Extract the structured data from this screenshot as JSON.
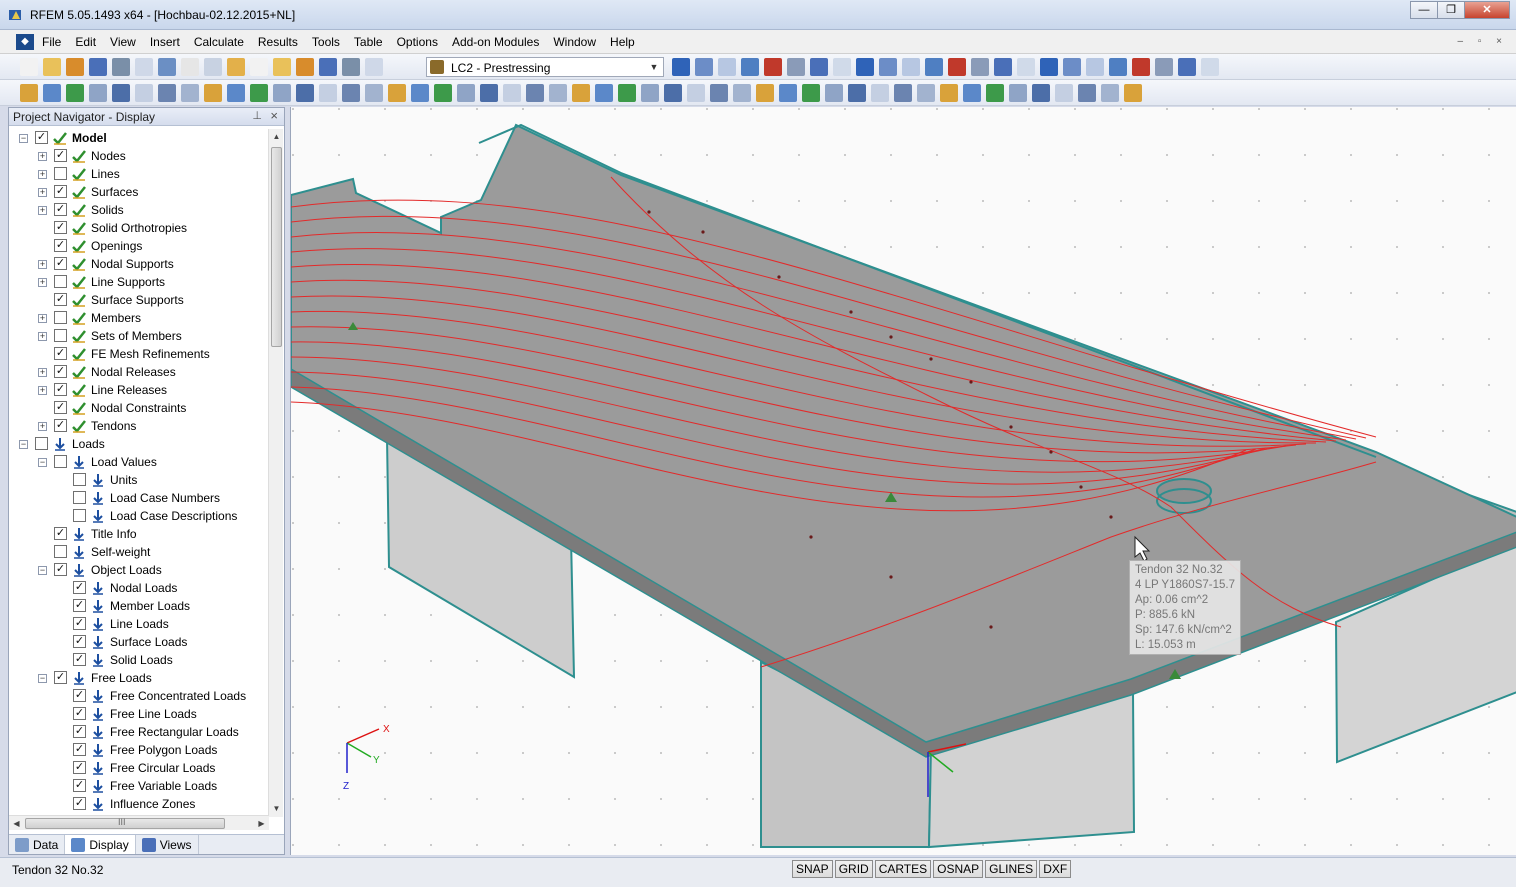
{
  "window": {
    "title": "RFEM 5.05.1493 x64 - [Hochbau-02.12.2015+NL]",
    "minimize": "—",
    "restore": "❐",
    "close": "✕"
  },
  "menu": {
    "items": [
      "File",
      "Edit",
      "View",
      "Insert",
      "Calculate",
      "Results",
      "Tools",
      "Table",
      "Options",
      "Add-on Modules",
      "Window",
      "Help"
    ],
    "mdi_controls": "‒ ▫ ×"
  },
  "toolbar": {
    "load_case": "LC2 - Prestressing"
  },
  "navigator": {
    "title": "Project Navigator - Display",
    "pin": "⊥",
    "close": "×",
    "items": [
      {
        "label": "Model",
        "level": 0,
        "exp": "−",
        "checked": true,
        "icon": "green-check-icon",
        "bold": true
      },
      {
        "label": "Nodes",
        "level": 1,
        "exp": "+",
        "checked": true,
        "icon": "green-check-icon"
      },
      {
        "label": "Lines",
        "level": 1,
        "exp": "+",
        "checked": false,
        "icon": "green-check-icon"
      },
      {
        "label": "Surfaces",
        "level": 1,
        "exp": "+",
        "checked": true,
        "icon": "green-check-icon"
      },
      {
        "label": "Solids",
        "level": 1,
        "exp": "+",
        "checked": true,
        "icon": "green-check-icon"
      },
      {
        "label": "Solid Orthotropies",
        "level": 1,
        "exp": "",
        "checked": true,
        "icon": "green-check-icon"
      },
      {
        "label": "Openings",
        "level": 1,
        "exp": "",
        "checked": true,
        "icon": "green-check-icon"
      },
      {
        "label": "Nodal Supports",
        "level": 1,
        "exp": "+",
        "checked": true,
        "icon": "green-check-icon"
      },
      {
        "label": "Line Supports",
        "level": 1,
        "exp": "+",
        "checked": false,
        "icon": "green-check-icon"
      },
      {
        "label": "Surface Supports",
        "level": 1,
        "exp": "",
        "checked": true,
        "icon": "green-check-icon"
      },
      {
        "label": "Members",
        "level": 1,
        "exp": "+",
        "checked": false,
        "icon": "green-check-icon"
      },
      {
        "label": "Sets of Members",
        "level": 1,
        "exp": "+",
        "checked": false,
        "icon": "green-check-icon"
      },
      {
        "label": "FE Mesh Refinements",
        "level": 1,
        "exp": "",
        "checked": true,
        "icon": "green-check-icon"
      },
      {
        "label": "Nodal Releases",
        "level": 1,
        "exp": "+",
        "checked": true,
        "icon": "green-check-icon"
      },
      {
        "label": "Line Releases",
        "level": 1,
        "exp": "+",
        "checked": true,
        "icon": "green-check-icon"
      },
      {
        "label": "Nodal Constraints",
        "level": 1,
        "exp": "",
        "checked": true,
        "icon": "green-check-icon"
      },
      {
        "label": "Tendons",
        "level": 1,
        "exp": "+",
        "checked": true,
        "icon": "green-check-icon"
      },
      {
        "label": "Loads",
        "level": 0,
        "exp": "−",
        "checked": false,
        "icon": "load-arrow-icon"
      },
      {
        "label": "Load Values",
        "level": 1,
        "exp": "−",
        "checked": false,
        "icon": "load-arrow-icon"
      },
      {
        "label": "Units",
        "level": 2,
        "exp": "",
        "checked": false,
        "icon": "load-arrow-icon"
      },
      {
        "label": "Load Case Numbers",
        "level": 2,
        "exp": "",
        "checked": false,
        "icon": "load-arrow-icon"
      },
      {
        "label": "Load Case Descriptions",
        "level": 2,
        "exp": "",
        "checked": false,
        "icon": "load-arrow-icon"
      },
      {
        "label": "Title Info",
        "level": 1,
        "exp": "",
        "checked": true,
        "icon": "load-arrow-icon"
      },
      {
        "label": "Self-weight",
        "level": 1,
        "exp": "",
        "checked": false,
        "icon": "load-arrow-icon"
      },
      {
        "label": "Object Loads",
        "level": 1,
        "exp": "−",
        "checked": true,
        "icon": "load-arrow-icon"
      },
      {
        "label": "Nodal Loads",
        "level": 2,
        "exp": "",
        "checked": true,
        "icon": "load-arrow-icon"
      },
      {
        "label": "Member Loads",
        "level": 2,
        "exp": "",
        "checked": true,
        "icon": "load-arrow-icon"
      },
      {
        "label": "Line Loads",
        "level": 2,
        "exp": "",
        "checked": true,
        "icon": "load-arrow-icon"
      },
      {
        "label": "Surface Loads",
        "level": 2,
        "exp": "",
        "checked": true,
        "icon": "load-arrow-icon"
      },
      {
        "label": "Solid Loads",
        "level": 2,
        "exp": "",
        "checked": true,
        "icon": "load-arrow-icon"
      },
      {
        "label": "Free Loads",
        "level": 1,
        "exp": "−",
        "checked": true,
        "icon": "load-arrow-icon"
      },
      {
        "label": "Free Concentrated Loads",
        "level": 2,
        "exp": "",
        "checked": true,
        "icon": "load-arrow-icon"
      },
      {
        "label": "Free Line Loads",
        "level": 2,
        "exp": "",
        "checked": true,
        "icon": "load-arrow-icon"
      },
      {
        "label": "Free Rectangular Loads",
        "level": 2,
        "exp": "",
        "checked": true,
        "icon": "load-arrow-icon"
      },
      {
        "label": "Free Polygon Loads",
        "level": 2,
        "exp": "",
        "checked": true,
        "icon": "load-arrow-icon"
      },
      {
        "label": "Free Circular Loads",
        "level": 2,
        "exp": "",
        "checked": true,
        "icon": "load-arrow-icon"
      },
      {
        "label": "Free Variable Loads",
        "level": 2,
        "exp": "",
        "checked": true,
        "icon": "load-arrow-icon"
      },
      {
        "label": "Influence Zones",
        "level": 2,
        "exp": "",
        "checked": true,
        "icon": "load-arrow-icon"
      }
    ],
    "tabs": [
      {
        "label": "Data",
        "icon": "data-icon"
      },
      {
        "label": "Display",
        "icon": "display-icon"
      },
      {
        "label": "Views",
        "icon": "views-icon"
      }
    ],
    "hscroll_label": "III"
  },
  "viewport": {
    "axes_labels": {
      "x": "X",
      "y": "Y",
      "z": "Z"
    },
    "tooltip": [
      "Tendon 32 No.32",
      "4 LP Y1860S7-15.7",
      "Ap: 0.06 cm^2",
      "P: 885.6 kN",
      "Sp: 147.6 kN/cm^2",
      "L: 15.053 m"
    ],
    "colors": {
      "tendon": "#e32a2a",
      "slab": "#9a9a9a",
      "edge": "#2e8f8f",
      "wall": "#cfcfcf"
    }
  },
  "status": {
    "text": "Tendon 32 No.32",
    "toggles": [
      "SNAP",
      "GRID",
      "CARTES",
      "OSNAP",
      "GLINES",
      "DXF"
    ]
  }
}
